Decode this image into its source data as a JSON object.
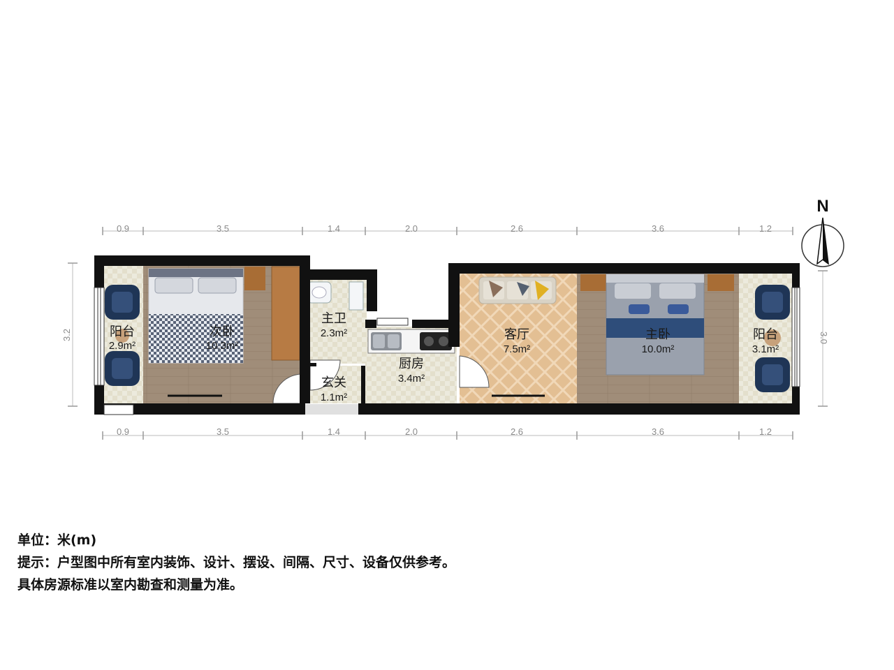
{
  "north_label": "N",
  "dimensions": {
    "top": [
      "0.9",
      "3.5",
      "1.4",
      "2.0",
      "2.6",
      "3.6",
      "1.2"
    ],
    "bottom": [
      "0.9",
      "3.5",
      "1.4",
      "2.0",
      "2.6",
      "3.6",
      "1.2"
    ],
    "left": "3.2",
    "right": "3.0"
  },
  "rooms": {
    "balcony_west": {
      "name": "阳台",
      "area": "2.9m²"
    },
    "second_bedroom": {
      "name": "次卧",
      "area": "10.3m²"
    },
    "bathroom": {
      "name": "主卫",
      "area": "2.3m²"
    },
    "entrance": {
      "name": "玄关",
      "area": "1.1m²"
    },
    "kitchen": {
      "name": "厨房",
      "area": "3.4m²"
    },
    "living_room": {
      "name": "客厅",
      "area": "7.5m²"
    },
    "master_bedroom": {
      "name": "主卧",
      "area": "10.0m²"
    },
    "balcony_east": {
      "name": "阳台",
      "area": "3.1m²"
    }
  },
  "notes": {
    "unit": "单位：米(m)",
    "hint": "提示：户型图中所有室内装饰、设计、摆设、间隔、尺寸、设备仅供参考。",
    "disclaimer": "具体房源标准以室内勘查和测量为准。"
  }
}
